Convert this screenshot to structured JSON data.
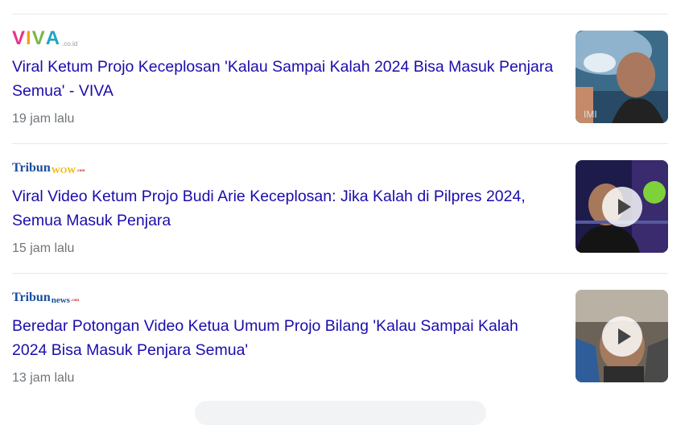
{
  "results": [
    {
      "source_logo": {
        "main": "VIVA",
        "suffix": ".co.id"
      },
      "title": "Viral Ketum Projo Keceplosan 'Kalau Sampai Kalah 2024 Bisa Masuk Penjara Semua' - VIVA",
      "time": "19 jam lalu",
      "has_video": false
    },
    {
      "source_logo": {
        "main": "Tribun",
        "second": "WOW",
        "suffix": ".com"
      },
      "title": "Viral Video Ketum Projo Budi Arie Keceplosan: Jika Kalah di Pilpres 2024, Semua Masuk Penjara",
      "time": "15 jam lalu",
      "has_video": true
    },
    {
      "source_logo": {
        "main": "Tribun",
        "second": "news",
        "suffix": ".com"
      },
      "title": "Beredar Potongan Video Ketua Umum Projo Bilang 'Kalau Sampai Kalah 2024 Bisa Masuk Penjara Semua'",
      "time": "13 jam lalu",
      "has_video": true
    }
  ],
  "colors": {
    "link": "#1a0dab",
    "meta": "#70757a",
    "divider": "#e8e8e8",
    "viva_v": "#e8338b",
    "viva_i": "#f3a21b",
    "viva_v2": "#7ab648",
    "viva_a": "#1fa3c8",
    "tribun_blue": "#1b4f9c",
    "tribunwow_yellow": "#f2b705",
    "tribunnews_red": "#d62a2a"
  },
  "icons": {
    "play": "play-icon"
  }
}
